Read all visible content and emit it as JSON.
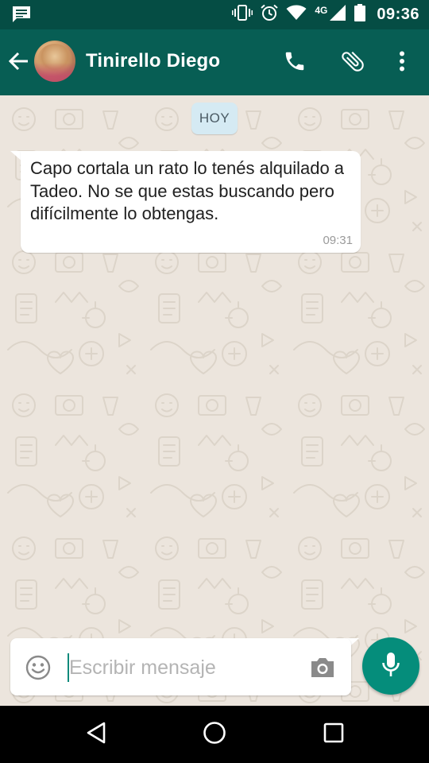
{
  "status_bar": {
    "time": "09:36",
    "network_type": "4G",
    "icons": [
      "message-notification-icon",
      "vibrate-icon",
      "alarm-icon",
      "wifi-icon",
      "signal-icon",
      "battery-icon"
    ]
  },
  "header": {
    "contact_name": "Tinirello Diego",
    "icons": [
      "back-arrow-icon",
      "avatar",
      "phone-icon",
      "paperclip-icon",
      "more-vert-icon"
    ]
  },
  "chat": {
    "date_chip": "HOY",
    "messages": [
      {
        "direction": "incoming",
        "text": "Capo cortala un rato lo tenés alquilado a Tadeo. No se que estas buscando pero difícilmente lo obtengas.",
        "time": "09:31"
      }
    ]
  },
  "composer": {
    "placeholder": "Escribir mensaje",
    "value": "",
    "icons": [
      "emoji-icon",
      "camera-icon",
      "mic-icon"
    ]
  },
  "nav_bar": {
    "icons": [
      "nav-back-icon",
      "nav-home-icon",
      "nav-recents-icon"
    ]
  },
  "colors": {
    "status_bar": "#054d44",
    "app_bar": "#075e54",
    "chat_background": "#ece5dd",
    "date_chip": "#d5eaf3",
    "mic_button": "#058d7b",
    "caret": "#0b8a7b"
  }
}
